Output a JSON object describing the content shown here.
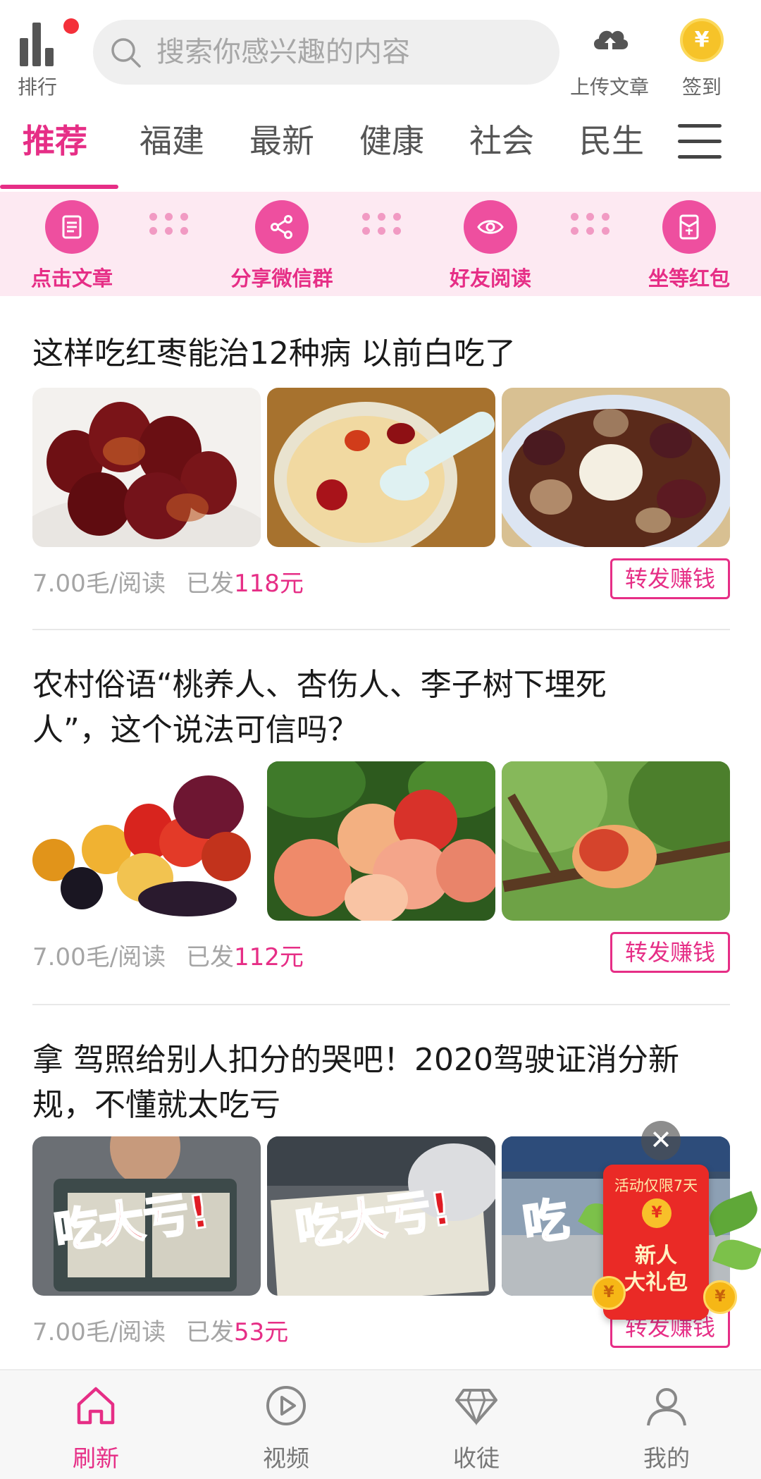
{
  "topbar": {
    "rank_label": "排行",
    "search_placeholder": "搜索你感兴趣的内容",
    "upload_label": "上传文章",
    "signin_label": "签到",
    "coin_symbol": "¥"
  },
  "tabs": [
    {
      "label": "推荐",
      "active": true
    },
    {
      "label": "福建",
      "active": false
    },
    {
      "label": "最新",
      "active": false
    },
    {
      "label": "健康",
      "active": false
    },
    {
      "label": "社会",
      "active": false
    },
    {
      "label": "民生",
      "active": false
    }
  ],
  "steps": [
    {
      "label": "点击文章",
      "icon": "document-icon"
    },
    {
      "label": "分享微信群",
      "icon": "share-icon"
    },
    {
      "label": "好友阅读",
      "icon": "eye-icon"
    },
    {
      "label": "坐等红包",
      "icon": "red-packet-icon"
    }
  ],
  "articles": [
    {
      "title": "这样吃红枣能治12种病 以前白吃了",
      "rate": "7.00毛/阅读",
      "sent_prefix": "已发",
      "sent_amount": "118元",
      "share_label": "转发赚钱"
    },
    {
      "title": "农村俗语“桃养人、杏伤人、李子树下埋死人”，这个说法可信吗？",
      "rate": "7.00毛/阅读",
      "sent_prefix": "已发",
      "sent_amount": "112元",
      "share_label": "转发赚钱"
    },
    {
      "title": "拿 驾照给别人扣分的哭吧！2020驾驶证消分新规，不懂就太吃亏",
      "rate": "7.00毛/阅读",
      "sent_prefix": "已发",
      "sent_amount": "53元",
      "share_label": "转发赚钱",
      "thumb_text": "吃大亏!",
      "thumb_text_partial": "吃"
    }
  ],
  "promo": {
    "close_symbol": "✕",
    "banner": "活动仅限7天",
    "coin_symbol": "¥",
    "line1": "新人",
    "line2": "大礼包"
  },
  "bottom_nav": [
    {
      "label": "刷新",
      "icon": "home-icon",
      "active": true
    },
    {
      "label": "视频",
      "icon": "play-icon",
      "active": false
    },
    {
      "label": "收徒",
      "icon": "diamond-icon",
      "active": false
    },
    {
      "label": "我的",
      "icon": "user-icon",
      "active": false
    }
  ],
  "colors": {
    "accent": "#e62e86",
    "step_strip_bg": "#fde9f2",
    "meta_gray": "#a5a5a5",
    "promo_red": "#ea2a26"
  }
}
